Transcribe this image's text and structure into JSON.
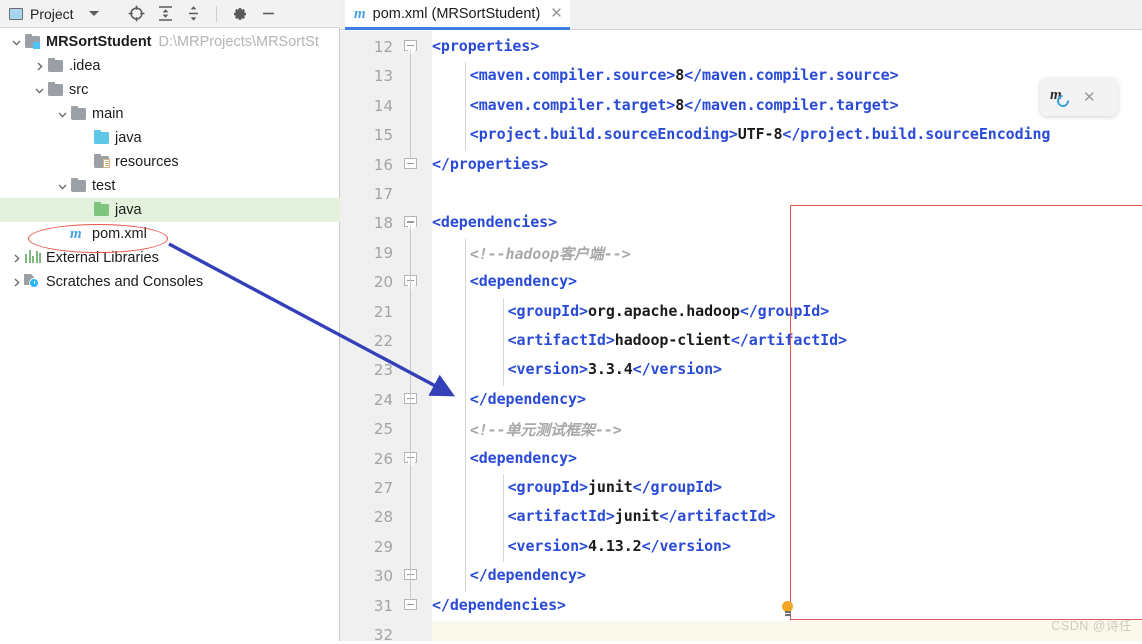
{
  "project_panel": {
    "title": "Project",
    "window_icon": "project-window-icon",
    "dropdown_icon": "chevron-down-icon",
    "toolbar_buttons": [
      {
        "name": "locate-icon",
        "label": "Select Opened File"
      },
      {
        "name": "expand-all-icon",
        "label": "Expand All"
      },
      {
        "name": "collapse-all-icon",
        "label": "Collapse All"
      },
      {
        "name": "gear-icon",
        "label": "Options"
      },
      {
        "name": "hide-icon",
        "label": "Hide"
      }
    ],
    "tree": [
      {
        "label": "MRSortStudent",
        "path": "D:\\MRProjects\\MRSortSt",
        "icon": "module-folder-icon",
        "arrow": "expanded",
        "depth": 0,
        "bold": true,
        "selected": false
      },
      {
        "label": ".idea",
        "path": "",
        "icon": "folder-grey-icon",
        "arrow": "collapsed",
        "depth": 1,
        "bold": false,
        "selected": false
      },
      {
        "label": "src",
        "path": "",
        "icon": "folder-grey-icon",
        "arrow": "expanded",
        "depth": 1,
        "bold": false,
        "selected": false
      },
      {
        "label": "main",
        "path": "",
        "icon": "folder-grey-icon",
        "arrow": "expanded",
        "depth": 2,
        "bold": false,
        "selected": false
      },
      {
        "label": "java",
        "path": "",
        "icon": "folder-cyan-source-icon",
        "arrow": "none",
        "depth": 3,
        "bold": false,
        "selected": false
      },
      {
        "label": "resources",
        "path": "",
        "icon": "folder-resources-icon",
        "arrow": "none",
        "depth": 3,
        "bold": false,
        "selected": false
      },
      {
        "label": "test",
        "path": "",
        "icon": "folder-grey-icon",
        "arrow": "expanded",
        "depth": 2,
        "bold": false,
        "selected": false
      },
      {
        "label": "java",
        "path": "",
        "icon": "folder-green-test-icon",
        "arrow": "none",
        "depth": 3,
        "bold": false,
        "selected": true
      },
      {
        "label": "pom.xml",
        "path": "",
        "icon": "maven-file-icon",
        "arrow": "none",
        "depth": 2,
        "bold": false,
        "selected": false
      },
      {
        "label": "External Libraries",
        "path": "",
        "icon": "libraries-icon",
        "arrow": "collapsed",
        "depth": 0,
        "bold": false,
        "selected": false
      },
      {
        "label": "Scratches and Consoles",
        "path": "",
        "icon": "scratches-icon",
        "arrow": "collapsed",
        "depth": 0,
        "bold": false,
        "selected": false
      }
    ]
  },
  "editor": {
    "tab": {
      "icon": "maven-file-icon",
      "label": "pom.xml (MRSortStudent)",
      "close_icon": "close-icon"
    },
    "first_line_number": 12,
    "current_line_number": 32,
    "lines": [
      {
        "num": 12,
        "indent": 0,
        "fold": "start",
        "segments": [
          {
            "t": "tag",
            "v": "<properties>"
          }
        ]
      },
      {
        "num": 13,
        "indent": 1,
        "fold": "none",
        "segments": [
          {
            "t": "tag",
            "v": "<maven.compiler.source>"
          },
          {
            "t": "txt",
            "v": "8"
          },
          {
            "t": "tag",
            "v": "</maven.compiler.source>"
          }
        ]
      },
      {
        "num": 14,
        "indent": 1,
        "fold": "none",
        "segments": [
          {
            "t": "tag",
            "v": "<maven.compiler.target>"
          },
          {
            "t": "txt",
            "v": "8"
          },
          {
            "t": "tag",
            "v": "</maven.compiler.target>"
          }
        ]
      },
      {
        "num": 15,
        "indent": 1,
        "fold": "none",
        "segments": [
          {
            "t": "tag",
            "v": "<project.build.sourceEncoding>"
          },
          {
            "t": "txt",
            "v": "UTF-8"
          },
          {
            "t": "tag",
            "v": "</project.build.sourceEncoding"
          }
        ]
      },
      {
        "num": 16,
        "indent": 0,
        "fold": "end",
        "segments": [
          {
            "t": "tag",
            "v": "</properties>"
          }
        ]
      },
      {
        "num": 17,
        "indent": 0,
        "fold": "none",
        "segments": []
      },
      {
        "num": 18,
        "indent": 0,
        "fold": "start",
        "segments": [
          {
            "t": "tag",
            "v": "<dependencies>"
          }
        ]
      },
      {
        "num": 19,
        "indent": 1,
        "fold": "none",
        "segments": [
          {
            "t": "cmt",
            "v": "<!--hadoop客户端-->"
          }
        ]
      },
      {
        "num": 20,
        "indent": 1,
        "fold": "start",
        "segments": [
          {
            "t": "tag",
            "v": "<dependency>"
          }
        ]
      },
      {
        "num": 21,
        "indent": 2,
        "fold": "none",
        "segments": [
          {
            "t": "tag",
            "v": "<groupId>"
          },
          {
            "t": "txt",
            "v": "org.apache.hadoop"
          },
          {
            "t": "tag",
            "v": "</groupId>"
          }
        ]
      },
      {
        "num": 22,
        "indent": 2,
        "fold": "none",
        "segments": [
          {
            "t": "tag",
            "v": "<artifactId>"
          },
          {
            "t": "txt",
            "v": "hadoop-client"
          },
          {
            "t": "tag",
            "v": "</artifactId>"
          }
        ]
      },
      {
        "num": 23,
        "indent": 2,
        "fold": "none",
        "segments": [
          {
            "t": "tag",
            "v": "<version>"
          },
          {
            "t": "txt",
            "v": "3.3.4"
          },
          {
            "t": "tag",
            "v": "</version>"
          }
        ]
      },
      {
        "num": 24,
        "indent": 1,
        "fold": "end",
        "segments": [
          {
            "t": "tag",
            "v": "</dependency>"
          }
        ]
      },
      {
        "num": 25,
        "indent": 1,
        "fold": "none",
        "segments": [
          {
            "t": "cmt",
            "v": "<!--单元测试框架-->"
          }
        ]
      },
      {
        "num": 26,
        "indent": 1,
        "fold": "start",
        "segments": [
          {
            "t": "tag",
            "v": "<dependency>"
          }
        ]
      },
      {
        "num": 27,
        "indent": 2,
        "fold": "none",
        "segments": [
          {
            "t": "tag",
            "v": "<groupId>"
          },
          {
            "t": "txt",
            "v": "junit"
          },
          {
            "t": "tag",
            "v": "</groupId>"
          }
        ]
      },
      {
        "num": 28,
        "indent": 2,
        "fold": "none",
        "segments": [
          {
            "t": "tag",
            "v": "<artifactId>"
          },
          {
            "t": "txt",
            "v": "junit"
          },
          {
            "t": "tag",
            "v": "</artifactId>"
          }
        ]
      },
      {
        "num": 29,
        "indent": 2,
        "fold": "none",
        "segments": [
          {
            "t": "tag",
            "v": "<version>"
          },
          {
            "t": "txt",
            "v": "4.13.2"
          },
          {
            "t": "tag",
            "v": "</version>"
          }
        ]
      },
      {
        "num": 30,
        "indent": 1,
        "fold": "end",
        "segments": [
          {
            "t": "tag",
            "v": "</dependency>"
          }
        ]
      },
      {
        "num": 31,
        "indent": 0,
        "fold": "end",
        "segments": [
          {
            "t": "tag",
            "v": "</dependencies>"
          }
        ]
      },
      {
        "num": 32,
        "indent": 0,
        "fold": "none",
        "segments": []
      }
    ]
  },
  "maven_popup": {
    "icon": "maven-reload-icon",
    "close_icon": "close-icon"
  },
  "intention_bulb": {
    "icon": "lightbulb-icon"
  },
  "annotations": {
    "ellipse_color": "#e8534c",
    "box_color": "#e8534c",
    "arrow_color": "#3340b8"
  },
  "watermark": "CSDN @诗任"
}
